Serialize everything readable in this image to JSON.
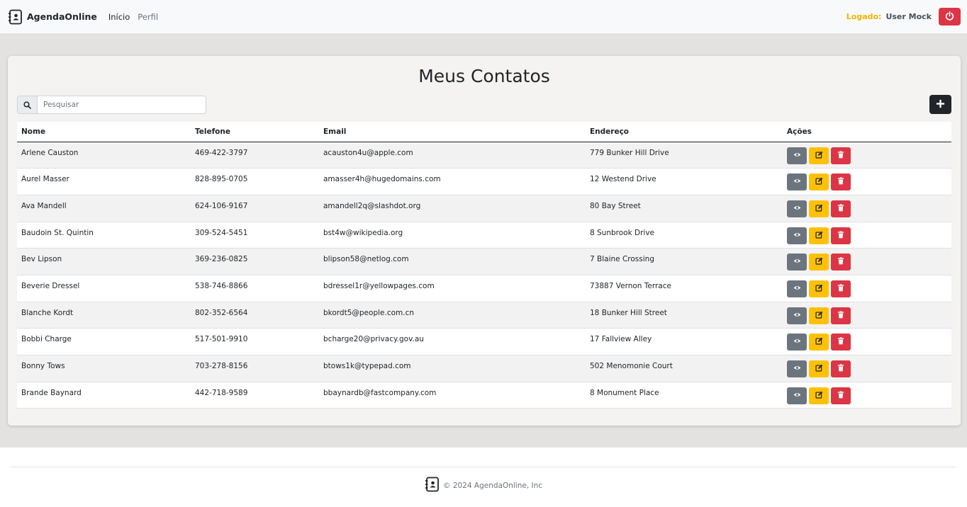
{
  "nav": {
    "brand": "AgendaOnline",
    "links": [
      "Início",
      "Perfil"
    ],
    "logged_label": "Logado:",
    "user_name": "User Mock"
  },
  "page": {
    "title": "Meus Contatos",
    "search_placeholder": "Pesquisar"
  },
  "table": {
    "headers": [
      "Nome",
      "Telefone",
      "Email",
      "Endereço",
      "Ações"
    ],
    "rows": [
      {
        "name": "Arlene Causton",
        "phone": "469-422-3797",
        "email": "acauston4u@apple.com",
        "address": "779 Bunker Hill Drive"
      },
      {
        "name": "Aurel Masser",
        "phone": "828-895-0705",
        "email": "amasser4h@hugedomains.com",
        "address": "12 Westend Drive"
      },
      {
        "name": "Ava Mandell",
        "phone": "624-106-9167",
        "email": "amandell2q@slashdot.org",
        "address": "80 Bay Street"
      },
      {
        "name": "Baudoin St. Quintin",
        "phone": "309-524-5451",
        "email": "bst4w@wikipedia.org",
        "address": "8 Sunbrook Drive"
      },
      {
        "name": "Bev Lipson",
        "phone": "369-236-0825",
        "email": "blipson58@netlog.com",
        "address": "7 Blaine Crossing"
      },
      {
        "name": "Beverie Dressel",
        "phone": "538-746-8866",
        "email": "bdressel1r@yellowpages.com",
        "address": "73887 Vernon Terrace"
      },
      {
        "name": "Blanche Kordt",
        "phone": "802-352-6564",
        "email": "bkordt5@people.com.cn",
        "address": "18 Bunker Hill Street"
      },
      {
        "name": "Bobbi Charge",
        "phone": "517-501-9910",
        "email": "bcharge20@privacy.gov.au",
        "address": "17 Fallview Alley"
      },
      {
        "name": "Bonny Tows",
        "phone": "703-278-8156",
        "email": "btows1k@typepad.com",
        "address": "502 Menomonie Court"
      },
      {
        "name": "Brande Baynard",
        "phone": "442-718-9589",
        "email": "bbaynardb@fastcompany.com",
        "address": "8 Monument Place"
      }
    ]
  },
  "footer": {
    "copyright": "© 2024 AgendaOnline, Inc"
  },
  "colors": {
    "danger": "#dc3545",
    "warning": "#ffc107",
    "secondary": "#6c757d",
    "dark": "#212529",
    "logged_label": "#f0b400"
  },
  "icons": {
    "brand": "address-book-icon",
    "logout": "power-icon",
    "search": "search-icon",
    "add": "plus-icon",
    "view": "eye-icon",
    "edit": "edit-icon",
    "delete": "trash-icon"
  }
}
